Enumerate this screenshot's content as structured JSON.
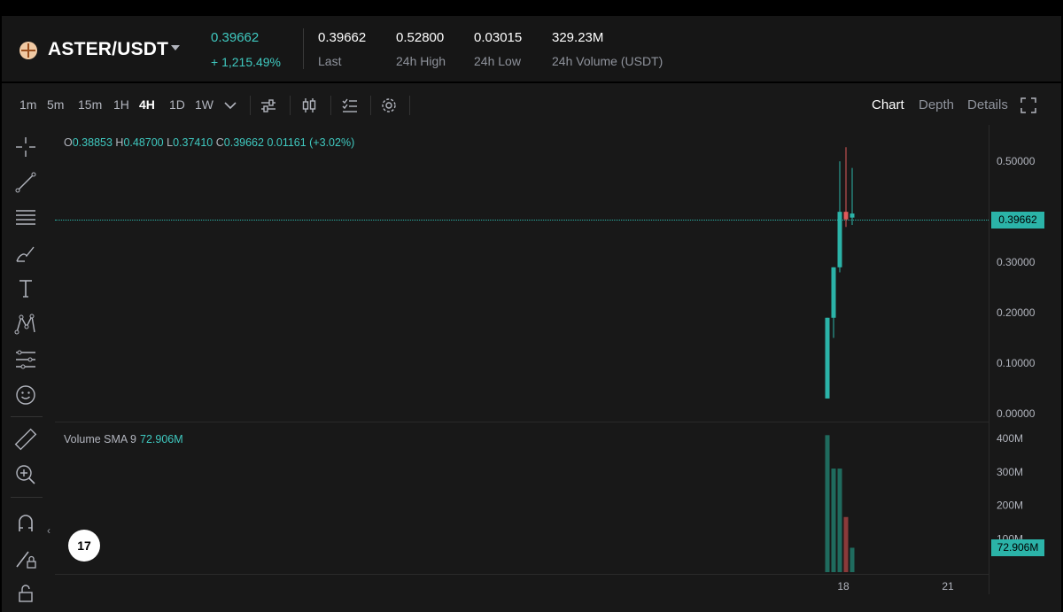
{
  "header": {
    "pair": "ASTER/USDT",
    "price": "0.39662",
    "change": "+ 1,215.49%",
    "stats": [
      {
        "value": "0.39662",
        "label": "Last"
      },
      {
        "value": "0.52800",
        "label": "24h High"
      },
      {
        "value": "0.03015",
        "label": "24h Low"
      },
      {
        "value": "329.23M",
        "label": "24h Volume (USDT)"
      }
    ]
  },
  "toolbar": {
    "timeframes": [
      "1m",
      "5m",
      "15m",
      "1H",
      "4H",
      "1D",
      "1W"
    ],
    "active_timeframe": "4H",
    "views": [
      "Chart",
      "Depth",
      "Details"
    ],
    "active_view": "Chart"
  },
  "left_tools": [
    "crosshair-icon",
    "trend-line-icon",
    "fib-lines-icon",
    "brush-icon",
    "text-icon",
    "pattern-icon",
    "forecast-icon",
    "emoji-icon",
    "ruler-icon",
    "zoom-in-icon",
    "magnet-icon",
    "lock-drawing-icon",
    "lock-icon"
  ],
  "ohlc": {
    "o_label": "O",
    "o": "0.38853",
    "h_label": "H",
    "h": "0.48700",
    "l_label": "L",
    "l": "0.37410",
    "c_label": "C",
    "c": "0.39662",
    "chg": "0.01161 (+3.02%)"
  },
  "volume": {
    "label": "Volume SMA 9",
    "value": "72.906M"
  },
  "tv_logo": "17",
  "colors": {
    "up": "#2bb3a8",
    "down": "#e05a5a",
    "vol_up": "#1f6b5e",
    "vol_down": "#8a3a3a"
  },
  "chart_data": {
    "type": "candlestick",
    "price_ticks": [
      "0.50000",
      "0.30000",
      "0.20000",
      "0.10000",
      "0.00000"
    ],
    "price_ticks_values": [
      0.5,
      0.3,
      0.2,
      0.1,
      0.0
    ],
    "last_price_label": "0.39662",
    "last_price": 0.39662,
    "ylim": [
      0,
      0.56
    ],
    "volume_ticks": [
      "400M",
      "300M",
      "200M",
      "100M"
    ],
    "volume_ticks_values": [
      400,
      300,
      200,
      100
    ],
    "volume_last_label": "72.906M",
    "volume_ylim": [
      0,
      440
    ],
    "x_ticks": [
      "18",
      "21"
    ],
    "candles": [
      {
        "o": 0.03,
        "h": 0.19,
        "l": 0.03,
        "c": 0.19,
        "v": 410
      },
      {
        "o": 0.19,
        "h": 0.29,
        "l": 0.15,
        "c": 0.29,
        "v": 310
      },
      {
        "o": 0.29,
        "h": 0.5,
        "l": 0.28,
        "c": 0.4,
        "v": 310
      },
      {
        "o": 0.4,
        "h": 0.528,
        "l": 0.37,
        "c": 0.385,
        "v": 165
      },
      {
        "o": 0.3885,
        "h": 0.487,
        "l": 0.374,
        "c": 0.3966,
        "v": 73
      }
    ]
  }
}
